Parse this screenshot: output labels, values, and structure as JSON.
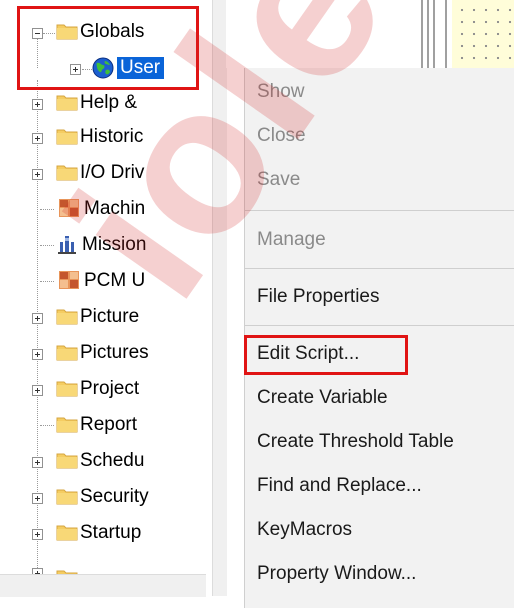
{
  "tree": {
    "items": [
      {
        "label": "Globals",
        "icon": "folder-icon",
        "expander": "minus"
      },
      {
        "label": "User",
        "icon": "globe-icon",
        "expander": "plus",
        "selected": true
      },
      {
        "label": "Help &",
        "icon": "folder-icon",
        "expander": "plus"
      },
      {
        "label": "Historic",
        "icon": "folder-icon",
        "expander": "plus"
      },
      {
        "label": "I/O Driv",
        "icon": "folder-icon",
        "expander": "plus"
      },
      {
        "label": "Machin",
        "icon": "machine-icon",
        "expander": "none"
      },
      {
        "label": "Mission",
        "icon": "mission-icon",
        "expander": "none"
      },
      {
        "label": "PCM U",
        "icon": "pcm-icon",
        "expander": "none"
      },
      {
        "label": "Picture",
        "icon": "folder-icon",
        "expander": "plus"
      },
      {
        "label": "Pictures",
        "icon": "folder-icon",
        "expander": "plus"
      },
      {
        "label": "Project",
        "icon": "folder-icon",
        "expander": "plus"
      },
      {
        "label": "Report",
        "icon": "folder-icon",
        "expander": "none"
      },
      {
        "label": "Schedu",
        "icon": "folder-icon",
        "expander": "plus"
      },
      {
        "label": "Security",
        "icon": "folder-icon",
        "expander": "plus"
      },
      {
        "label": "Startup",
        "icon": "folder-icon",
        "expander": "plus"
      }
    ]
  },
  "context_menu": {
    "items": [
      {
        "label": "Show",
        "enabled": false
      },
      {
        "label": "Close",
        "enabled": false
      },
      {
        "label": "Save",
        "enabled": false
      },
      {
        "label": "Manage",
        "enabled": false
      },
      {
        "label": "File Properties",
        "enabled": true
      },
      {
        "label": "Edit Script...",
        "enabled": true,
        "highlighted": true
      },
      {
        "label": "Create Variable",
        "enabled": true
      },
      {
        "label": "Create Threshold Table",
        "enabled": true
      },
      {
        "label": "Find and Replace...",
        "enabled": true
      },
      {
        "label": "KeyMacros",
        "enabled": true
      },
      {
        "label": "Property Window...",
        "enabled": true
      }
    ]
  },
  "watermark": {
    "text": "iolek"
  },
  "colors": {
    "selection": "#0a64d8",
    "callout": "#e01414",
    "folder": "#f5cd62",
    "canvas": "#fffdd9"
  }
}
